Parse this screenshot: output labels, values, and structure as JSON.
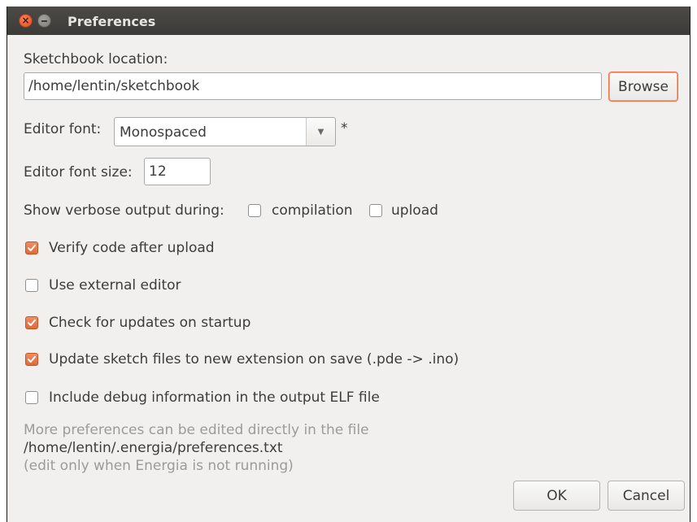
{
  "window": {
    "title": "Preferences"
  },
  "sketchbook": {
    "label": "Sketchbook location:",
    "path": "/home/lentin/sketchbook",
    "browse_label": "Browse"
  },
  "editor_font": {
    "label": "Editor font:",
    "value": "Monospaced",
    "asterisk": "*"
  },
  "editor_font_size": {
    "label": "Editor font size:",
    "value": "12"
  },
  "verbose": {
    "label": "Show verbose output during:",
    "compilation_label": "compilation",
    "compilation_checked": false,
    "upload_label": "upload",
    "upload_checked": false
  },
  "options": [
    {
      "label": "Verify code after upload",
      "checked": true
    },
    {
      "label": "Use external editor",
      "checked": false
    },
    {
      "label": "Check for updates on startup",
      "checked": true
    },
    {
      "label": "Update sketch files to new extension on save (.pde -> .ino)",
      "checked": true
    },
    {
      "label": "Include debug information in the output ELF file",
      "checked": false
    }
  ],
  "footer": {
    "note": "More preferences can be edited directly in the file",
    "file_path": "/home/lentin/.energia/preferences.txt",
    "warning": "(edit only when Energia is not running)"
  },
  "buttons": {
    "ok_label": "OK",
    "cancel_label": "Cancel"
  },
  "colors": {
    "accent": "#e06a36",
    "titlebar": "#3c3b37",
    "background": "#f1f0ef"
  }
}
